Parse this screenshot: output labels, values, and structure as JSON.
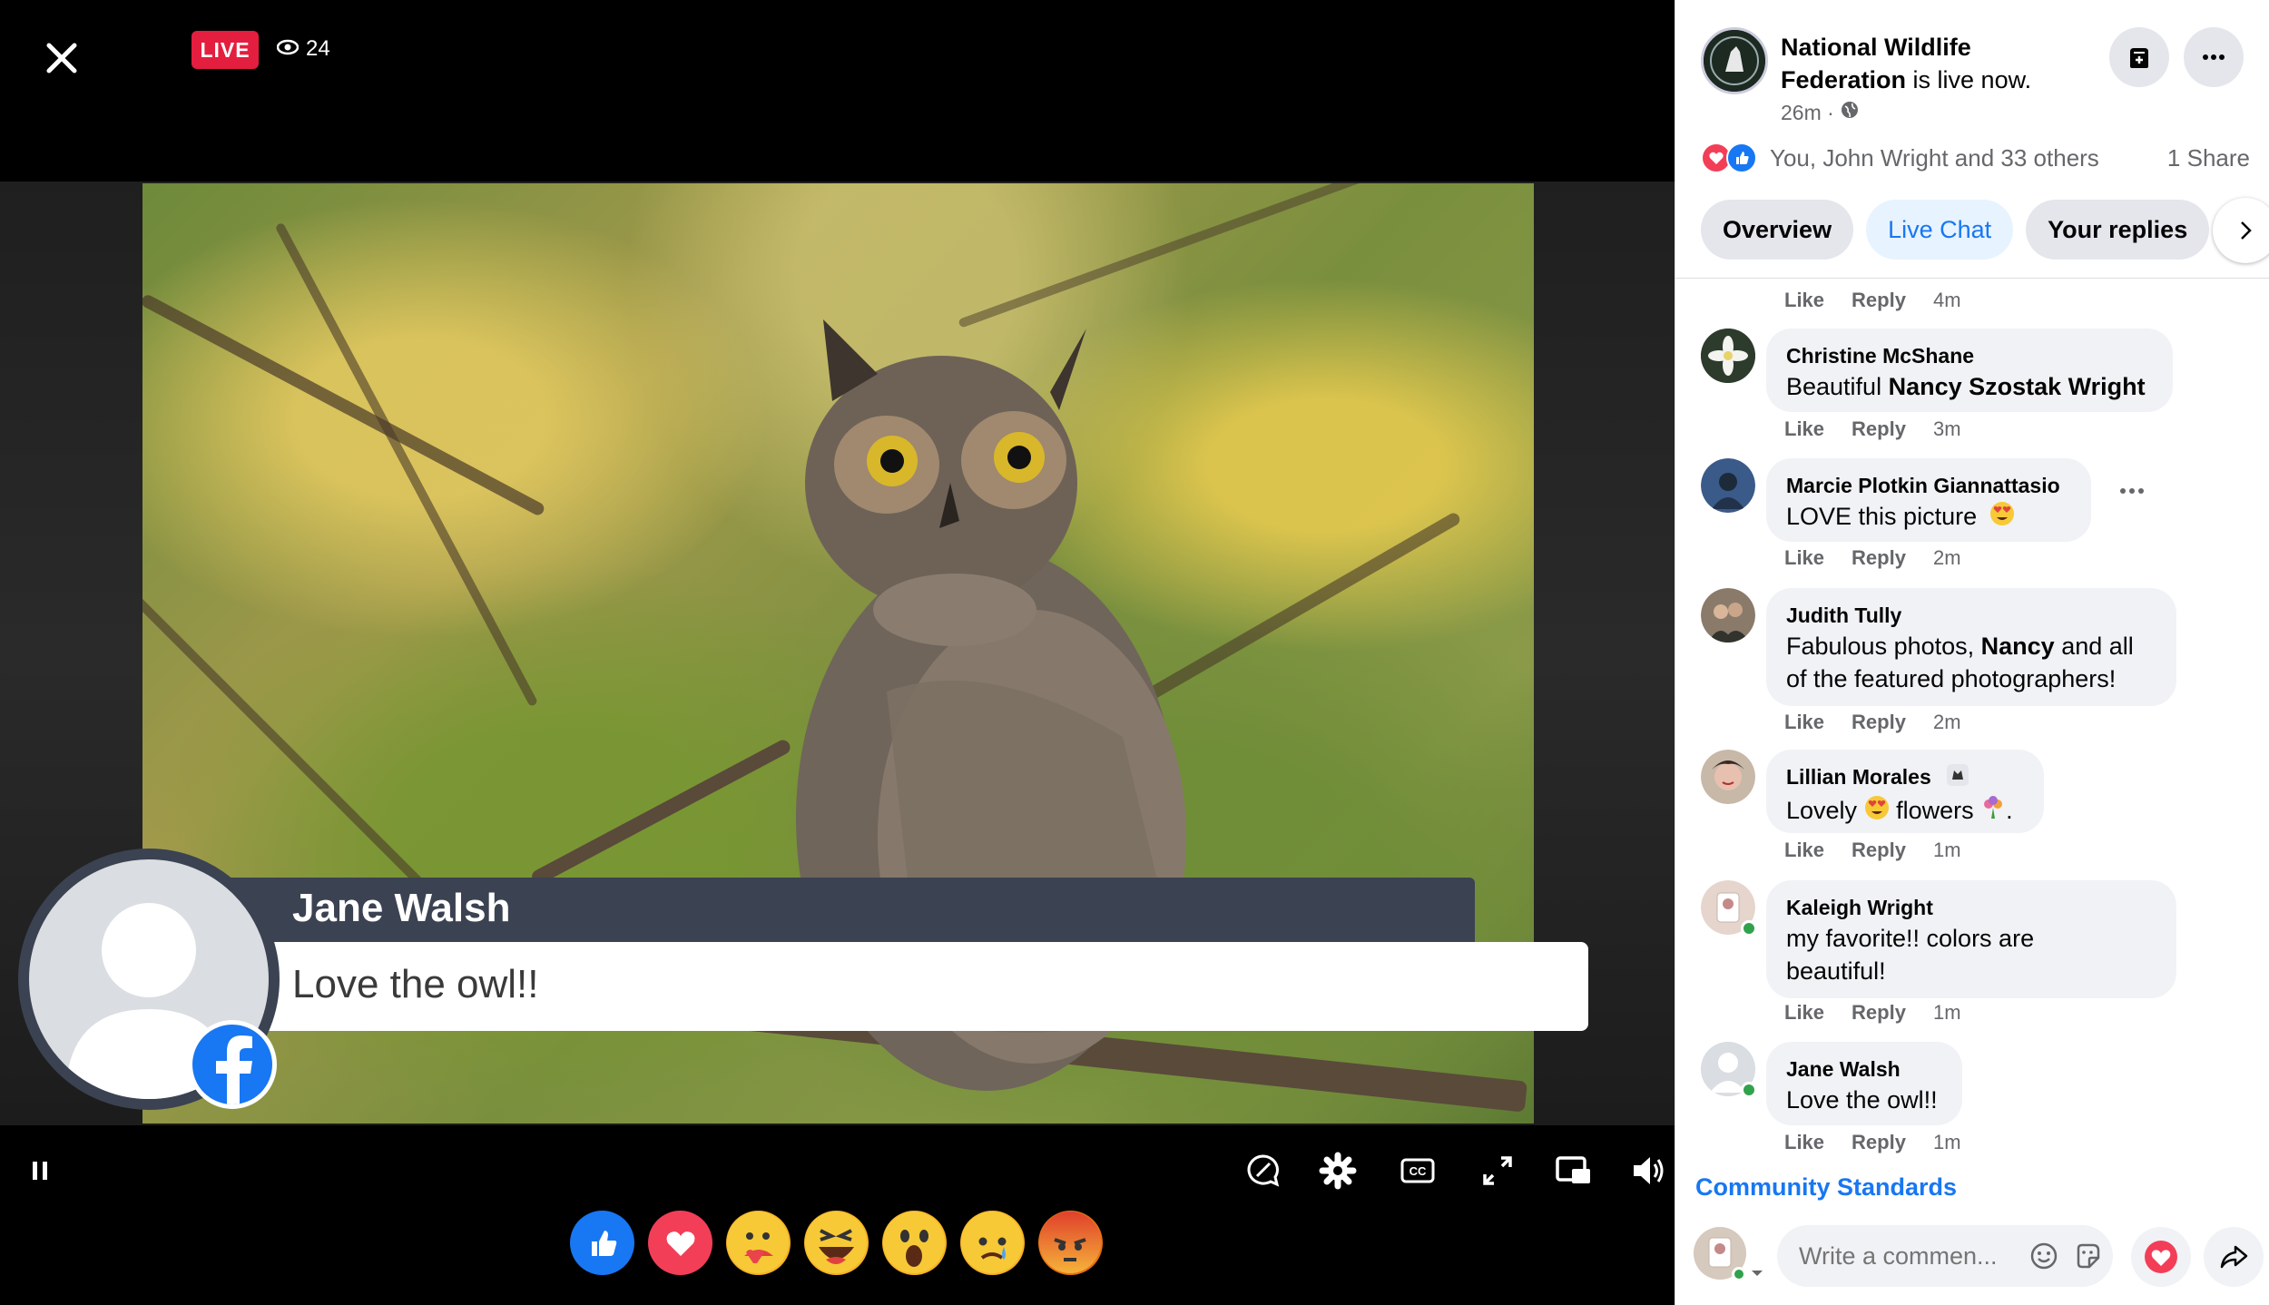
{
  "video": {
    "live_label": "LIVE",
    "viewer_count": "24",
    "lower_third": {
      "name": "Jane Walsh",
      "message": "Love the owl!!"
    }
  },
  "panel": {
    "page_name": "National Wildlife Federation",
    "live_status": "is live now.",
    "time": "26m ·",
    "reactions_text": "You, John Wright and 33 others",
    "shares": "1 Share",
    "tabs": [
      {
        "label": "Overview"
      },
      {
        "label": "Live Chat"
      },
      {
        "label": "Your replies"
      }
    ],
    "action_like": "Like",
    "action_reply": "Reply",
    "comments": [
      {
        "name": "",
        "text": "",
        "time": "4m"
      },
      {
        "name": "Christine McShane",
        "text_pre": "Beautiful ",
        "text_bold": "Nancy Szostak Wright",
        "time": "3m"
      },
      {
        "name": "Marcie Plotkin Giannattasio",
        "text": "LOVE this picture",
        "time": "2m"
      },
      {
        "name": "Judith Tully",
        "text_pre": "Fabulous photos, ",
        "text_bold": "Nancy",
        "text_post": " and all",
        "text_line2": "of the featured photographers!",
        "time": "2m"
      },
      {
        "name": "Lillian Morales",
        "text_a": "Lovely",
        "text_b": "flowers",
        "text_c": ".",
        "time": "1m"
      },
      {
        "name": "Kaleigh Wright",
        "text_line1": "my favorite!! colors are",
        "text_line2": "beautiful!",
        "time": "1m"
      },
      {
        "name": "Jane Walsh",
        "text": "Love the owl!!",
        "time": "1m"
      }
    ],
    "community_standards": "Community Standards",
    "composer_placeholder": "Write a commen..."
  },
  "icons": [
    "close-icon",
    "eye-icon",
    "pause-icon",
    "comment-toggle-icon",
    "gear-icon",
    "captions-icon",
    "fullscreen-icon",
    "picture-in-picture-icon",
    "volume-icon",
    "like-reaction",
    "love-reaction",
    "care-reaction",
    "haha-reaction",
    "wow-reaction",
    "sad-reaction",
    "angry-reaction",
    "save-icon",
    "more-icon",
    "globe-icon",
    "chevron-right-icon",
    "emoji-icon",
    "sticker-icon",
    "heart-icon",
    "share-icon"
  ],
  "colors": {
    "live_red": "#e41e3f",
    "fb_blue": "#1877f2",
    "lower_third_bar": "#3b4252"
  }
}
